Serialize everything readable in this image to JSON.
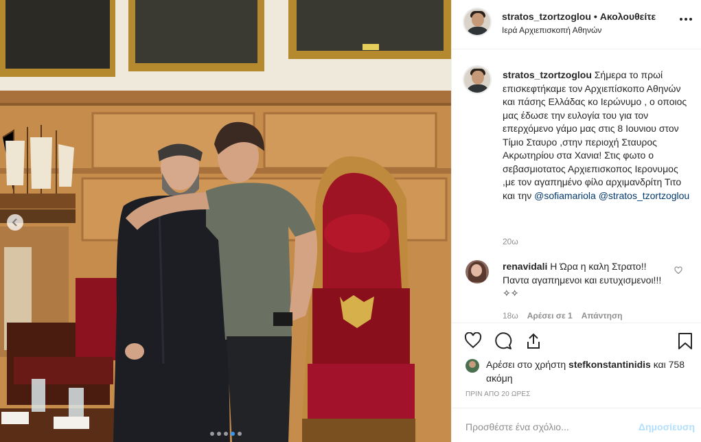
{
  "post": {
    "username": "stratos_tzortzoglou",
    "separator": "•",
    "follow_status": "Ακολουθείτε",
    "location": "Ιερά Αρχιεπισκοπή Αθηνών",
    "caption_username": "stratos_tzortzoglou",
    "caption_text": "Σήμερα το πρωί επισκεφτήκαμε τον Αρχιεπίσκοπο Αθηνών και πάσης Ελλάδας κο Ιερώνυμο , ο οποιος μας έδωσε την ευλογία του για τον επερχόμενο γάμο μας στις 8 Ιουνιου στον Τίμιο Σταυρο ,στην περιοχή Σταυρος Ακρωτηρίου στα Χανια! Στις φωτο ο σεβασμιοτατος Αρχιεπισκοπος Ιερονυμος ,με τον αγαπημένο φίλο αρχιμανδρίτη Τιτο και την",
    "caption_mention_1": "@sofiamariola",
    "caption_mention_2": "@stratos_tzortzoglou",
    "caption_time": "20ω",
    "carousel_dots": 5,
    "carousel_active": 4
  },
  "comment": {
    "username": "renavidali",
    "text": "Η Ώρα η καλη Στρατο!!Παντα αγαπημενοι και ευτυχισμενοι!!!✧✧",
    "time": "18ω",
    "likes": "Αρέσει σε 1",
    "reply": "Απάντηση"
  },
  "likes": {
    "prefix": "Αρέσει στο χρήστη",
    "user": "stefkonstantinidis",
    "suffix": "και 758 ακόμη"
  },
  "posted_ago": "ΠΡΙΝ ΑΠΟ 20 ΩΡΕΣ",
  "add_comment": {
    "placeholder": "Προσθέστε ένα σχόλιο...",
    "post_label": "Δημοσίευση"
  },
  "icons": {
    "like": "heart-icon",
    "comment": "comment-icon",
    "share": "share-icon",
    "save": "bookmark-icon",
    "more": "more-icon"
  },
  "colors": {
    "link": "#00376b",
    "post_disabled": "#b2dffc",
    "secondary_text": "#8e8e8e",
    "carousel_active": "#3897f0"
  }
}
